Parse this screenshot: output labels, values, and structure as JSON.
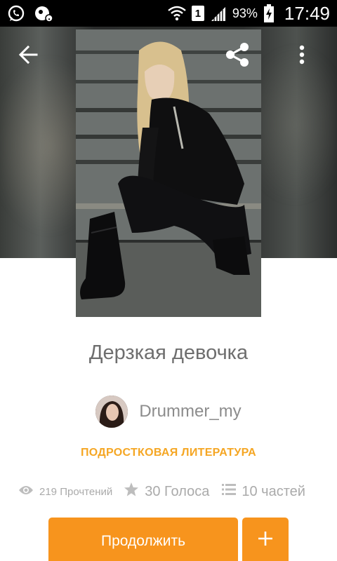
{
  "status_bar": {
    "sim_slot": "1",
    "battery_percent": "93%",
    "time": "17:49",
    "icons": [
      "whatsapp-icon",
      "notification-icon",
      "wifi-icon",
      "signal-icon",
      "battery-charging-icon"
    ]
  },
  "toolbar": {
    "icons": [
      "back-arrow-icon",
      "share-icon",
      "more-vert-icon"
    ]
  },
  "story": {
    "title": "Дерзкая девочка",
    "author": "Drummer_my",
    "genre": "ПОДРОСТКОВАЯ ЛИТЕРАТУРА",
    "reads": "219 Прочтений",
    "votes": "30 Голоса",
    "parts": "10 частей"
  },
  "actions": {
    "continue_label": "Продолжить",
    "add_label": "+"
  },
  "colors": {
    "accent": "#f7941d",
    "genre": "#f5a623",
    "muted": "#aaaaaa",
    "title": "#6e6e6e"
  }
}
